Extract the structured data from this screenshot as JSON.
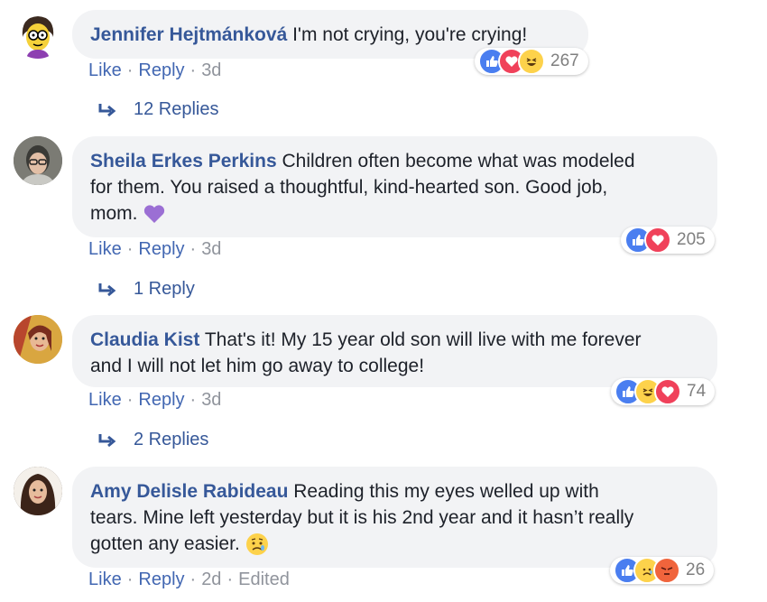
{
  "comments": [
    {
      "author": "Jennifer Hejtmánková",
      "text": "I'm not crying, you're crying!",
      "like_label": "Like",
      "reply_label": "Reply",
      "time": "3d",
      "reaction_count": "267",
      "reactions": [
        "like-icon",
        "love-icon",
        "haha-icon"
      ],
      "replies_label": "12 Replies"
    },
    {
      "author": "Sheila Erkes Perkins",
      "text_line1": "Children often become what was modeled",
      "text_line2": "for them. You raised a thoughtful, kind-hearted son. Good job,",
      "text_line3": "mom.",
      "like_label": "Like",
      "reply_label": "Reply",
      "time": "3d",
      "reaction_count": "205",
      "reactions": [
        "like-icon",
        "love-icon"
      ],
      "replies_label": "1 Reply"
    },
    {
      "author": "Claudia Kist",
      "text_line1": "That's it! My 15 year old son will live with me forever",
      "text_line2": "and I will not let him go away to college!",
      "like_label": "Like",
      "reply_label": "Reply",
      "time": "3d",
      "reaction_count": "74",
      "reactions": [
        "like-icon",
        "haha-icon",
        "love-icon"
      ],
      "replies_label": "2 Replies"
    },
    {
      "author": "Amy Delisle Rabideau",
      "text_line1": "Reading this my eyes welled up with",
      "text_line2": "tears. Mine left yesterday but it is his 2nd year and it hasn’t really",
      "text_line3": "gotten any easier.",
      "like_label": "Like",
      "reply_label": "Reply",
      "time": "2d",
      "edited_label": "Edited",
      "reaction_count": "26",
      "reactions": [
        "like-icon",
        "sad-icon",
        "angry-icon"
      ]
    }
  ],
  "colors": {
    "author": "#365899",
    "link": "#4267b2",
    "meta": "#90949c",
    "bubble": "#f2f3f5",
    "like": "#4a7ef0",
    "love": "#f0415a",
    "haha": "#fdd24b"
  }
}
